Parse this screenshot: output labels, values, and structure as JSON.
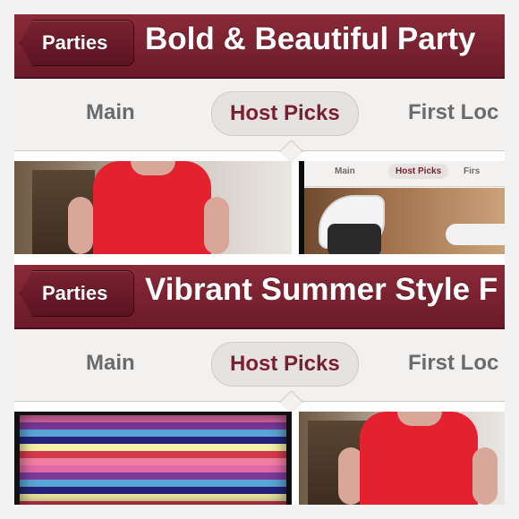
{
  "panels": [
    {
      "back_label": "Parties",
      "title": "Bold & Beautiful Party",
      "tabs": [
        "Main",
        "Host Picks",
        "First Loc"
      ],
      "photos": [
        {
          "name": "red-top-photo"
        },
        {
          "name": "app-screenshot-photo",
          "mini_tabs": [
            "Main",
            "Host Picks",
            "Firs"
          ]
        }
      ]
    },
    {
      "back_label": "Parties",
      "title": "Vibrant Summer Style F",
      "tabs": [
        "Main",
        "Host Picks",
        "First Loc"
      ],
      "photos": [
        {
          "name": "striped-fabric-photo"
        },
        {
          "name": "red-top-photo"
        }
      ]
    }
  ],
  "colors": {
    "header": "#7a2131",
    "active_tab_text": "#7a1f2d",
    "inactive_tab_text": "#6b6b6b"
  }
}
